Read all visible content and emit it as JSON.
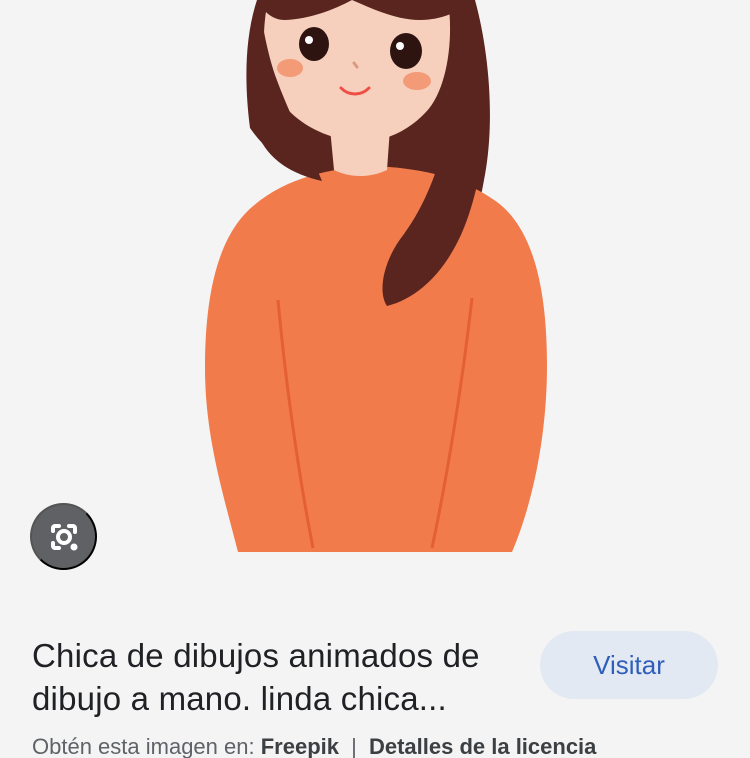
{
  "result": {
    "title": "Chica de dibujos animados de dibujo a mano. linda chica...",
    "visit_label": "Visitar",
    "source_prefix": "Obtén esta imagen en:",
    "source_name": "Freepik",
    "divider": "|",
    "license_label": "Detalles de la licencia"
  },
  "icons": {
    "lens": "google-lens-icon"
  },
  "colors": {
    "background": "#f4f4f4",
    "sweater": "#f27b4b",
    "hair": "#5a241f",
    "skin": "#f6d0bd",
    "visit_button_bg": "#e3e9f3",
    "visit_button_text": "#2f5eb9",
    "lens_button": "#5f6164"
  }
}
